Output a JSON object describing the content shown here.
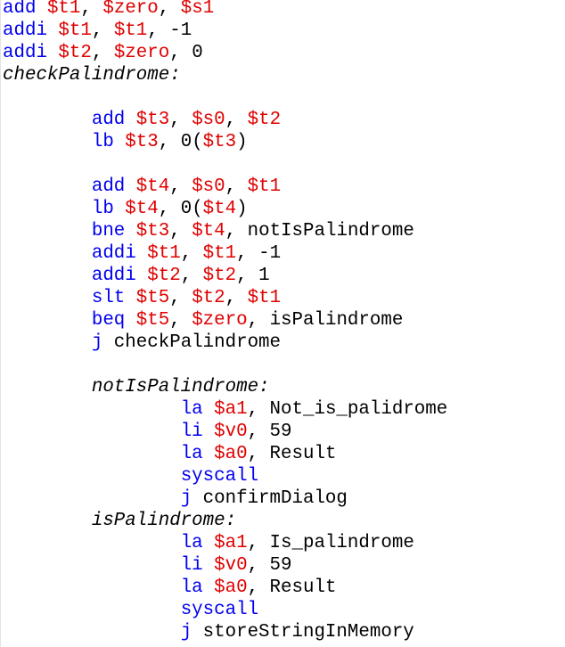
{
  "editor": {
    "lines": [
      {
        "indent": 0,
        "tokens": [
          {
            "t": "kw",
            "v": "add"
          },
          {
            "t": "plain",
            "v": " "
          },
          {
            "t": "reg",
            "v": "$t1"
          },
          {
            "t": "plain",
            "v": ", "
          },
          {
            "t": "reg",
            "v": "$zero"
          },
          {
            "t": "plain",
            "v": ", "
          },
          {
            "t": "reg",
            "v": "$s1"
          }
        ]
      },
      {
        "indent": 0,
        "tokens": [
          {
            "t": "kw",
            "v": "addi"
          },
          {
            "t": "plain",
            "v": " "
          },
          {
            "t": "reg",
            "v": "$t1"
          },
          {
            "t": "plain",
            "v": ", "
          },
          {
            "t": "reg",
            "v": "$t1"
          },
          {
            "t": "plain",
            "v": ", -1"
          }
        ]
      },
      {
        "indent": 0,
        "tokens": [
          {
            "t": "kw",
            "v": "addi"
          },
          {
            "t": "plain",
            "v": " "
          },
          {
            "t": "reg",
            "v": "$t2"
          },
          {
            "t": "plain",
            "v": ", "
          },
          {
            "t": "reg",
            "v": "$zero"
          },
          {
            "t": "plain",
            "v": ", 0"
          }
        ]
      },
      {
        "indent": 0,
        "tokens": [
          {
            "t": "lbl",
            "v": "checkPalindrome:"
          }
        ]
      },
      {
        "indent": 0,
        "tokens": []
      },
      {
        "indent": 1,
        "tokens": [
          {
            "t": "kw",
            "v": "add"
          },
          {
            "t": "plain",
            "v": " "
          },
          {
            "t": "reg",
            "v": "$t3"
          },
          {
            "t": "plain",
            "v": ", "
          },
          {
            "t": "reg",
            "v": "$s0"
          },
          {
            "t": "plain",
            "v": ", "
          },
          {
            "t": "reg",
            "v": "$t2"
          }
        ]
      },
      {
        "indent": 1,
        "tokens": [
          {
            "t": "kw",
            "v": "lb"
          },
          {
            "t": "plain",
            "v": " "
          },
          {
            "t": "reg",
            "v": "$t3"
          },
          {
            "t": "plain",
            "v": ", 0("
          },
          {
            "t": "reg",
            "v": "$t3"
          },
          {
            "t": "plain",
            "v": ")"
          }
        ]
      },
      {
        "indent": 0,
        "tokens": []
      },
      {
        "indent": 1,
        "tokens": [
          {
            "t": "kw",
            "v": "add"
          },
          {
            "t": "plain",
            "v": " "
          },
          {
            "t": "reg",
            "v": "$t4"
          },
          {
            "t": "plain",
            "v": ", "
          },
          {
            "t": "reg",
            "v": "$s0"
          },
          {
            "t": "plain",
            "v": ", "
          },
          {
            "t": "reg",
            "v": "$t1"
          }
        ]
      },
      {
        "indent": 1,
        "tokens": [
          {
            "t": "kw",
            "v": "lb"
          },
          {
            "t": "plain",
            "v": " "
          },
          {
            "t": "reg",
            "v": "$t4"
          },
          {
            "t": "plain",
            "v": ", 0("
          },
          {
            "t": "reg",
            "v": "$t4"
          },
          {
            "t": "plain",
            "v": ")"
          }
        ]
      },
      {
        "indent": 1,
        "tokens": [
          {
            "t": "kw",
            "v": "bne"
          },
          {
            "t": "plain",
            "v": " "
          },
          {
            "t": "reg",
            "v": "$t3"
          },
          {
            "t": "plain",
            "v": ", "
          },
          {
            "t": "reg",
            "v": "$t4"
          },
          {
            "t": "plain",
            "v": ", notIsPalindrome"
          }
        ]
      },
      {
        "indent": 1,
        "tokens": [
          {
            "t": "kw",
            "v": "addi"
          },
          {
            "t": "plain",
            "v": " "
          },
          {
            "t": "reg",
            "v": "$t1"
          },
          {
            "t": "plain",
            "v": ", "
          },
          {
            "t": "reg",
            "v": "$t1"
          },
          {
            "t": "plain",
            "v": ", -1"
          }
        ]
      },
      {
        "indent": 1,
        "tokens": [
          {
            "t": "kw",
            "v": "addi"
          },
          {
            "t": "plain",
            "v": " "
          },
          {
            "t": "reg",
            "v": "$t2"
          },
          {
            "t": "plain",
            "v": ", "
          },
          {
            "t": "reg",
            "v": "$t2"
          },
          {
            "t": "plain",
            "v": ", 1"
          }
        ]
      },
      {
        "indent": 1,
        "tokens": [
          {
            "t": "kw",
            "v": "slt"
          },
          {
            "t": "plain",
            "v": " "
          },
          {
            "t": "reg",
            "v": "$t5"
          },
          {
            "t": "plain",
            "v": ", "
          },
          {
            "t": "reg",
            "v": "$t2"
          },
          {
            "t": "plain",
            "v": ", "
          },
          {
            "t": "reg",
            "v": "$t1"
          }
        ]
      },
      {
        "indent": 1,
        "tokens": [
          {
            "t": "kw",
            "v": "beq"
          },
          {
            "t": "plain",
            "v": " "
          },
          {
            "t": "reg",
            "v": "$t5"
          },
          {
            "t": "plain",
            "v": ", "
          },
          {
            "t": "reg",
            "v": "$zero"
          },
          {
            "t": "plain",
            "v": ", isPalindrome"
          }
        ]
      },
      {
        "indent": 1,
        "tokens": [
          {
            "t": "kw",
            "v": "j"
          },
          {
            "t": "plain",
            "v": " checkPalindrome"
          }
        ]
      },
      {
        "indent": 0,
        "tokens": []
      },
      {
        "indent": 1,
        "tokens": [
          {
            "t": "lbl",
            "v": "notIsPalindrome:"
          }
        ]
      },
      {
        "indent": 2,
        "tokens": [
          {
            "t": "kw",
            "v": "la"
          },
          {
            "t": "plain",
            "v": " "
          },
          {
            "t": "reg",
            "v": "$a1"
          },
          {
            "t": "plain",
            "v": ", Not_is_palidrome"
          }
        ]
      },
      {
        "indent": 2,
        "tokens": [
          {
            "t": "kw",
            "v": "li"
          },
          {
            "t": "plain",
            "v": " "
          },
          {
            "t": "reg",
            "v": "$v0"
          },
          {
            "t": "plain",
            "v": ", 59"
          }
        ]
      },
      {
        "indent": 2,
        "tokens": [
          {
            "t": "kw",
            "v": "la"
          },
          {
            "t": "plain",
            "v": " "
          },
          {
            "t": "reg",
            "v": "$a0"
          },
          {
            "t": "plain",
            "v": ", Result"
          }
        ]
      },
      {
        "indent": 2,
        "tokens": [
          {
            "t": "kw",
            "v": "syscall"
          }
        ]
      },
      {
        "indent": 2,
        "tokens": [
          {
            "t": "kw",
            "v": "j"
          },
          {
            "t": "plain",
            "v": " confirmDialog"
          }
        ]
      },
      {
        "indent": 1,
        "tokens": [
          {
            "t": "lbl",
            "v": "isPalindrome:"
          }
        ]
      },
      {
        "indent": 2,
        "tokens": [
          {
            "t": "kw",
            "v": "la"
          },
          {
            "t": "plain",
            "v": " "
          },
          {
            "t": "reg",
            "v": "$a1"
          },
          {
            "t": "plain",
            "v": ", Is_palindrome"
          }
        ]
      },
      {
        "indent": 2,
        "tokens": [
          {
            "t": "kw",
            "v": "li"
          },
          {
            "t": "plain",
            "v": " "
          },
          {
            "t": "reg",
            "v": "$v0"
          },
          {
            "t": "plain",
            "v": ", 59"
          }
        ]
      },
      {
        "indent": 2,
        "tokens": [
          {
            "t": "kw",
            "v": "la"
          },
          {
            "t": "plain",
            "v": " "
          },
          {
            "t": "reg",
            "v": "$a0"
          },
          {
            "t": "plain",
            "v": ", Result"
          }
        ]
      },
      {
        "indent": 2,
        "tokens": [
          {
            "t": "kw",
            "v": "syscall"
          }
        ]
      },
      {
        "indent": 2,
        "tokens": [
          {
            "t": "kw",
            "v": "j"
          },
          {
            "t": "plain",
            "v": " storeStringInMemory"
          }
        ]
      }
    ]
  },
  "colors": {
    "instruction": "#0000ee",
    "register": "#e00000",
    "label": "#000000",
    "background": "#ffffff"
  }
}
